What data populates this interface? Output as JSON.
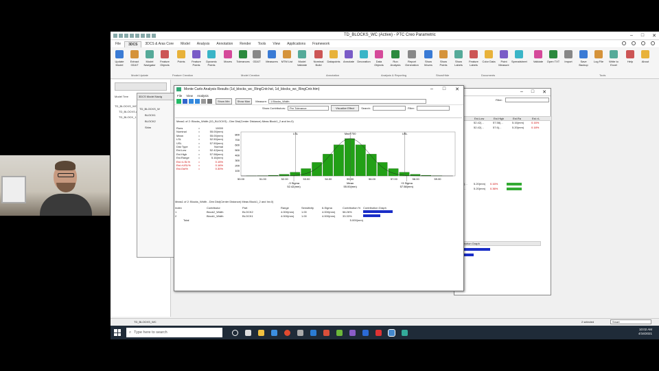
{
  "window_title": "TD_BLOCKS_WC (Active) - PTC Creo Parametric",
  "menubar": {
    "tabs": [
      "File",
      "3DCS",
      "3DCS & Aras Core",
      "Model",
      "Analysis",
      "Annotation",
      "Render",
      "Tools",
      "View",
      "Applications",
      "Framework"
    ],
    "active": "3DCS"
  },
  "ribbon": {
    "buttons": [
      "Update Model",
      "Extract GD&T",
      "Model Navigator",
      "Feature Objects",
      "Points",
      "Feature Points",
      "Dynamic Points",
      "Moves",
      "Tolerances",
      "GD&T",
      "Measures",
      "MTM List",
      "Model Validate",
      "Nominal Build",
      "Datapoints",
      "Annotate",
      "Decoration",
      "Data Objects",
      "Run Analysis",
      "Report Generation",
      "Show Moves",
      "Show Points",
      "Show Labels",
      "Feature Labels",
      "Color Data",
      "Point Measure",
      "Spreadsheet",
      "Validate",
      "Open TXT",
      "Import",
      "Save Backup",
      "Log File",
      "Write to Excel",
      "Help",
      "About"
    ],
    "groups": [
      "Model Update",
      "Feature Creation",
      "Model Creation",
      "Annotation",
      "Analysis & Reporting",
      "Show/Hide",
      "Documents",
      "Tools"
    ]
  },
  "left_panel": {
    "tab": "Model Tree",
    "items": [
      "TD_BLOCKS_WC.ASM",
      "TD_BLOCKS.ASM",
      "TD_BLOCK_1.PRT"
    ]
  },
  "nav_window": {
    "title": "3DCS Model Navig",
    "items": [
      "TD_BLOCKS_W",
      "BLOCK1",
      "BLOCK2",
      "Shim"
    ]
  },
  "mc": {
    "title": "Monte Carlo Analysis Results (1d_blocks_wc_RingCntr.hst, 1d_blocks_wc_RingCntr.htm)",
    "menu": [
      "File",
      "View",
      "Analysis"
    ],
    "show_min": "Show Min",
    "show_max": "Show Max",
    "measure_label": "Measure:",
    "measure_value": "1 Blocks_Width",
    "show_contributors_label": "Show Contributors:",
    "show_contributors_value": "Per Tolerance",
    "visualize_effect": "Visualize Effect",
    "search_label": "Search:",
    "filter_label": "Filter:",
    "pane_title": "Meas1 of 2: Blocks_Width (1D_BLOCKS) - Dim Dist(Center Distance) Meas Block1_2 and Inv.0)",
    "stats": [
      {
        "k": "Runs",
        "v": "10000"
      },
      {
        "k": "Nominal",
        "v": "55.00(mm)"
      },
      {
        "k": "Mean",
        "v": "55.00(mm)"
      },
      {
        "k": "LSL",
        "v": "52.50(mm)"
      },
      {
        "k": "USL",
        "v": "57.50(mm)"
      },
      {
        "k": "Dist Type",
        "v": "Normal"
      },
      {
        "k": "Est.Low",
        "v": "52.42(mm)"
      },
      {
        "k": "Est.High",
        "v": "57.58(mm)"
      },
      {
        "k": "Est.Range",
        "v": "5.16(mm)"
      },
      {
        "k": "Est.<LSL%",
        "v": "0.15%",
        "red": true
      },
      {
        "k": "Est.>USL%",
        "v": "0.16%",
        "red": true
      },
      {
        "k": "Est.Out%",
        "v": "0.30%",
        "red": true
      }
    ],
    "table_title": "Meas1 of 2: Blocks_Width - Dim Dist(Center Distance) Meas Block1_2 and Inv.0)",
    "table_headers": [
      "Index",
      "Contributor",
      "Part",
      "Range",
      "Sensitivity",
      "6-Sigma",
      "Contribution %",
      "Contribution Graph"
    ],
    "table_rows": [
      {
        "c": [
          "1",
          "Block2_Width",
          "BLOCK2",
          "4.000(mm)",
          "1.00",
          "4.000(mm)",
          "58.26%"
        ],
        "pct": 58.26
      },
      {
        "c": [
          "2",
          "Block1_Width",
          "BLOCK1",
          "4.000(mm)",
          "1.00",
          "4.000(mm)",
          "33.33%"
        ],
        "pct": 33.33
      }
    ],
    "table_total": "5.000(mm)",
    "total_label": "Total"
  },
  "chart_data": {
    "type": "bar",
    "x": [
      50,
      50.5,
      51,
      51.5,
      52,
      52.5,
      53,
      53.5,
      54,
      54.5,
      55,
      55.5,
      56,
      56.5,
      57,
      57.5,
      58,
      58.5,
      59
    ],
    "values": [
      0,
      1,
      4,
      12,
      30,
      70,
      140,
      260,
      420,
      600,
      720,
      600,
      420,
      260,
      140,
      70,
      30,
      12,
      4
    ],
    "xticks": [
      "50.00",
      "51.00",
      "52.00",
      "53.00",
      "54.00",
      "55.00",
      "56.00",
      "57.00",
      "58.00",
      "59.00"
    ],
    "yticks": [
      "100",
      "200",
      "300",
      "400",
      "500",
      "600",
      "700",
      "800"
    ],
    "ylim": [
      0,
      850
    ],
    "xlim": [
      50,
      59.8
    ],
    "markers": [
      {
        "label": "LSL",
        "x": 52.5
      },
      {
        "label": "Max+700",
        "x": 55
      },
      {
        "label": "USL",
        "x": 57.5
      }
    ],
    "bottom_labels": [
      {
        "t1": "-3 Sigma",
        "t2": "52.42(mm)",
        "x": 52.42
      },
      {
        "t1": "Mean",
        "t2": "55.00(mm)",
        "x": 55
      },
      {
        "t1": "+3 Sigma",
        "t2": "57.58(mm)",
        "x": 57.58
      }
    ],
    "bar_color": "#22a016"
  },
  "win3": {
    "headers": [
      "Type",
      "Est.Low",
      "Est.High",
      "Est.Ra",
      "Est.<L"
    ],
    "rows": [
      [
        "Normal",
        "52.42(...",
        "57.58(...",
        "5.16(mm)",
        "0.16%"
      ],
      [
        "Normal",
        "52.42(...",
        "57.6(...",
        "5.20(mm)",
        "0.18%"
      ]
    ],
    "filter": "Filter:",
    "rows2": [
      [
        "57.60(...",
        "5.20(mm)",
        "0.16%"
      ],
      [
        "57.6(...",
        "5.20(mm)",
        "0.36%"
      ]
    ],
    "graph_label": "Contribution Graph"
  },
  "status": {
    "left": "TD_BLOCKS_WC",
    "right": "2 selected",
    "mode": "Smart"
  },
  "taskbar": {
    "search": "Type here to search",
    "time": "10:02 AM",
    "date": "4/16/2021"
  }
}
